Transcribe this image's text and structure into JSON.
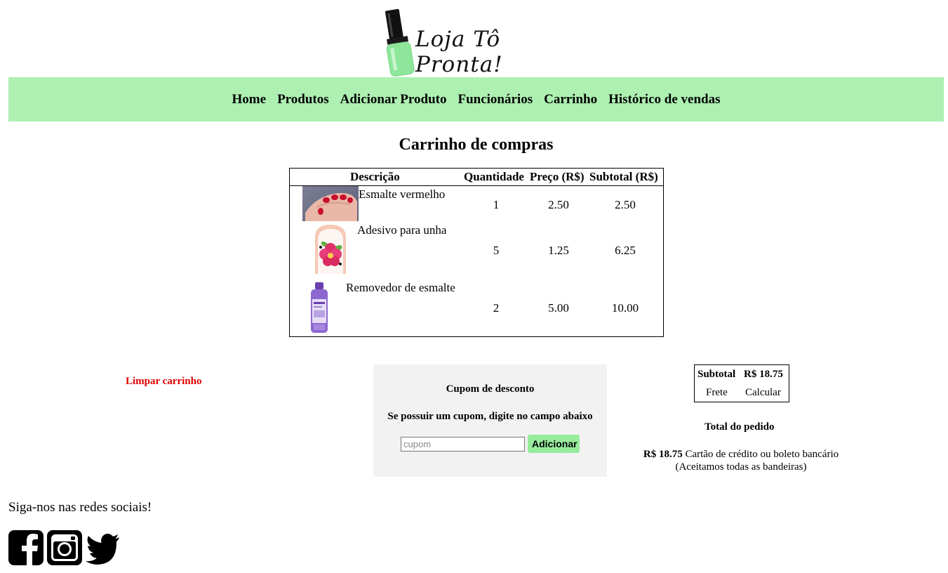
{
  "brand": {
    "name": "Loja Tô Pronta!"
  },
  "nav": {
    "items": [
      "Home",
      "Produtos",
      "Adicionar Produto",
      "Funcionários",
      "Carrinho",
      "Histórico de vendas"
    ]
  },
  "page_title": "Carrinho de compras",
  "cart": {
    "headers": {
      "description": "Descrição",
      "quantity": "Quantidade",
      "price": "Preço (R$)",
      "subtotal": "Subtotal (R$)"
    },
    "items": [
      {
        "description": "Esmalte vermelho",
        "quantity": "1",
        "price": "2.50",
        "subtotal": "2.50",
        "image": "red-nails-photo"
      },
      {
        "description": "Adesivo para unha",
        "quantity": "5",
        "price": "1.25",
        "subtotal": "6.25",
        "image": "flower-nail-sticker-photo"
      },
      {
        "description": "Removedor de esmalte",
        "quantity": "2",
        "price": "5.00",
        "subtotal": "10.00",
        "image": "polish-remover-bottle-photo"
      }
    ]
  },
  "clear_cart_label": "Limpar carrinho",
  "coupon": {
    "title": "Cupom de desconto",
    "instructions": "Se possuir um cupom, digite no campo abaixo",
    "placeholder": "cupom",
    "value": "",
    "button_label": "Adicionar"
  },
  "totals": {
    "subtotal_label": "Subtotal",
    "subtotal_value": "R$ 18.75",
    "shipping_label": "Frete",
    "shipping_action": "Calcular",
    "order_total_label": "Total do pedido",
    "order_total_value": "R$ 18.75",
    "payment_text": "Cartão de crédito ou boleto bancário",
    "payment_note": "(Aceitamos todas as bandeiras)"
  },
  "footer": {
    "follow_text": "Siga-nos nas redes sociais!",
    "social": [
      "facebook-icon",
      "instagram-icon",
      "twitter-icon"
    ]
  },
  "colors": {
    "nav_bg": "#adf0b2",
    "button_bg": "#97ec9c",
    "clear_red": "#e00000",
    "coupon_bg": "#f2f2f2",
    "polish_green": "#8ee69a"
  }
}
